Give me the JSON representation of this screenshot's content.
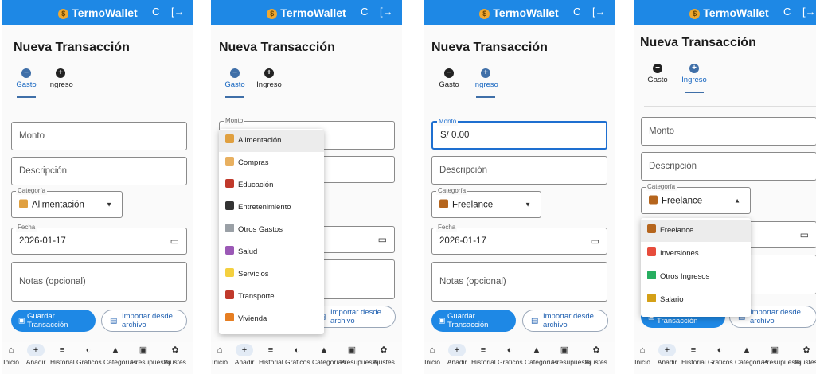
{
  "app": {
    "title": "TermoWallet",
    "logo_glyph": "$",
    "refresh_icon": "C",
    "logout_icon": "[→"
  },
  "form": {
    "page_title": "Nueva Transacción",
    "tabs": [
      {
        "label": "Gasto",
        "icon": "−"
      },
      {
        "label": "Ingreso",
        "icon": "+"
      }
    ],
    "monto_placeholder": "Monto",
    "monto_label": "Monto",
    "monto_value": "S/ 0.00",
    "descripcion_placeholder": "Descripción",
    "categoria_label": "Categoría",
    "fecha_label": "Fecha",
    "fecha_value": "2026-01-17",
    "notas_placeholder": "Notas (opcional)",
    "save_label": "Guardar Transacción",
    "import_label": "Importar desde archivo"
  },
  "screens": [
    {
      "active_tab": "Gasto",
      "categoria_value": "Alimentación"
    },
    {
      "active_tab": "Gasto",
      "menu_open": true
    },
    {
      "active_tab": "Ingreso",
      "categoria_value": "Freelance"
    },
    {
      "active_tab": "Ingreso",
      "categoria_value": "Freelance",
      "menu_open": true
    }
  ],
  "expense_categories": [
    {
      "label": "Alimentación",
      "color": "#e0a040"
    },
    {
      "label": "Compras",
      "color": "#e8b060"
    },
    {
      "label": "Educación",
      "color": "#c0392b"
    },
    {
      "label": "Entretenimiento",
      "color": "#333333"
    },
    {
      "label": "Otros Gastos",
      "color": "#9aa0a6"
    },
    {
      "label": "Salud",
      "color": "#9b59b6"
    },
    {
      "label": "Servicios",
      "color": "#f4d03f"
    },
    {
      "label": "Transporte",
      "color": "#c0392b"
    },
    {
      "label": "Vivienda",
      "color": "#e67e22"
    }
  ],
  "income_categories": [
    {
      "label": "Freelance",
      "color": "#b5651d"
    },
    {
      "label": "Inversiones",
      "color": "#e74c3c"
    },
    {
      "label": "Otros Ingresos",
      "color": "#27ae60"
    },
    {
      "label": "Salario",
      "color": "#d4a017"
    }
  ],
  "nav": [
    {
      "label": "Inicio",
      "icon": "⌂"
    },
    {
      "label": "Añadir",
      "icon": "+"
    },
    {
      "label": "Historial",
      "icon": "≡"
    },
    {
      "label": "Gráficos",
      "icon": "◐"
    },
    {
      "label": "Categorías",
      "icon": "▲"
    },
    {
      "label": "Presupuesto",
      "icon": "▣"
    },
    {
      "label": "Ajustes",
      "icon": "✿"
    }
  ],
  "colors": {
    "primary": "#1e88e5",
    "tab_active": "#3f6fa8",
    "focus": "#1e6fd0"
  }
}
